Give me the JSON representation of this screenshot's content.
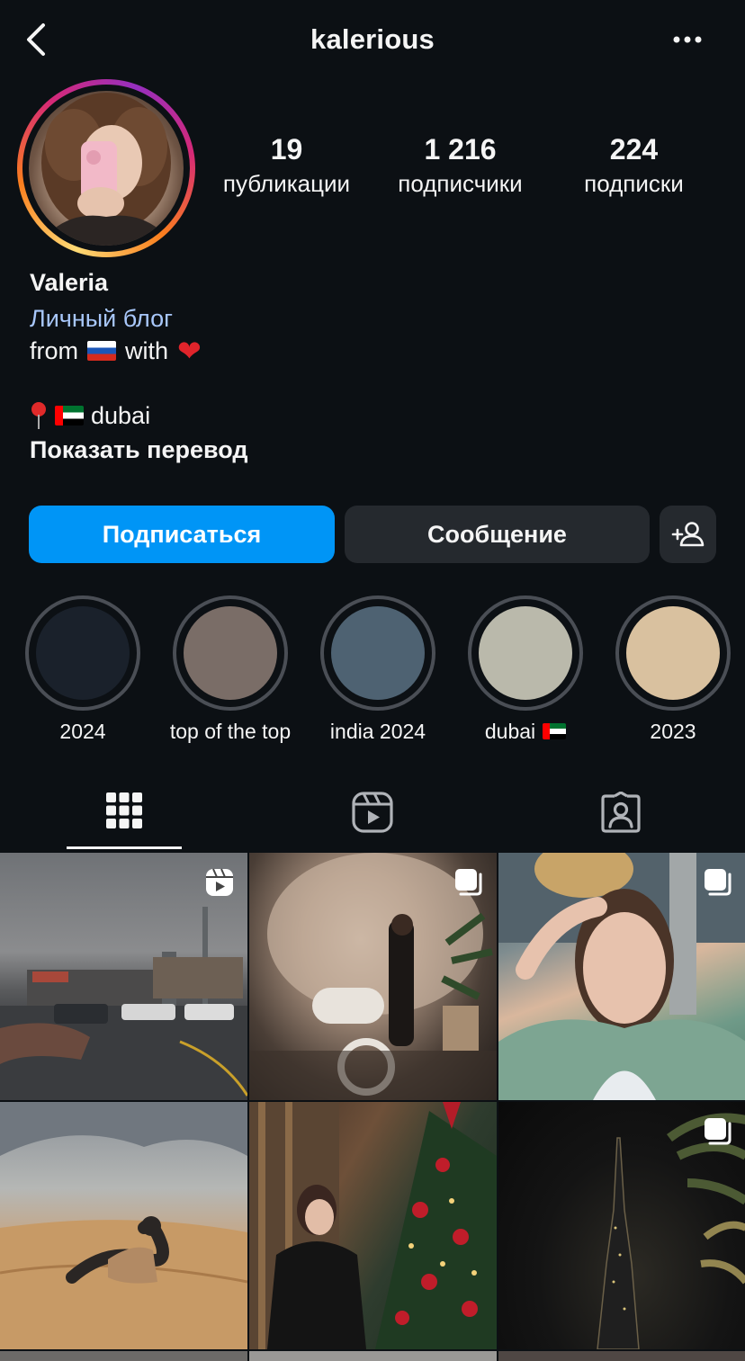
{
  "header": {
    "username": "kalerious"
  },
  "profile": {
    "stats": [
      {
        "value": "19",
        "label": "публикации"
      },
      {
        "value": "1 216",
        "label": "подписчики"
      },
      {
        "value": "224",
        "label": "подписки"
      }
    ],
    "name": "Valeria",
    "category": "Личный блог",
    "bio_from": "from",
    "bio_with": "with",
    "location": "dubai",
    "translate_label": "Показать перевод"
  },
  "actions": {
    "follow_label": "Подписаться",
    "message_label": "Сообщение"
  },
  "highlights": [
    {
      "label": "2024",
      "color": "#1a212b"
    },
    {
      "label": "top of the top",
      "color": "#7a6d67"
    },
    {
      "label": "india 2024",
      "color": "#4e6272"
    },
    {
      "label": "dubai",
      "color": "#bab9ab"
    },
    {
      "label": "2023",
      "color": "#d9c19f"
    }
  ],
  "tabs": [
    {
      "name": "posts-grid",
      "icon": "grid-icon",
      "active": true
    },
    {
      "name": "reels",
      "icon": "reels-icon",
      "active": false
    },
    {
      "name": "tagged",
      "icon": "tagged-person-icon",
      "active": false
    }
  ],
  "posts": [
    {
      "type": "reel",
      "icon": "reel-badge-icon"
    },
    {
      "type": "carousel",
      "icon": "carousel-badge-icon"
    },
    {
      "type": "carousel",
      "icon": "carousel-badge-icon"
    },
    {
      "type": "photo"
    },
    {
      "type": "photo"
    },
    {
      "type": "carousel",
      "icon": "carousel-badge-icon"
    }
  ],
  "colors": {
    "background": "#0c1014",
    "follow_button": "#0095f6",
    "secondary_button": "#25292e",
    "category_link": "#a8c7fa"
  }
}
